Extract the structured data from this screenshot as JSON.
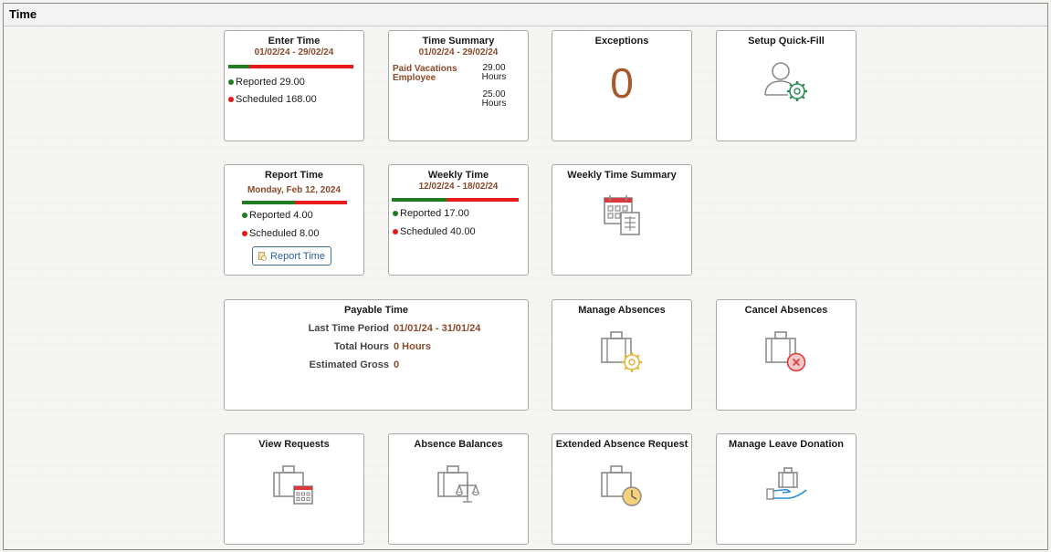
{
  "window": {
    "title": "Time"
  },
  "tiles": {
    "enter_time": {
      "title": "Enter Time",
      "date_range": "01/02/24 - 29/02/24",
      "reported_fraction": 0.17,
      "reported": "Reported 29.00",
      "scheduled": "Scheduled 168.00"
    },
    "time_summary": {
      "title": "Time Summary",
      "date_range": "01/02/24 - 29/02/24",
      "label_1": "Paid Vacations",
      "label_2": "Employee",
      "value_1_num": "29.00",
      "value_1_unit": "Hours",
      "value_2_num": "25.00",
      "value_2_unit": "Hours"
    },
    "exceptions": {
      "title": "Exceptions",
      "count": "0"
    },
    "setup_quickfill": {
      "title": "Setup Quick-Fill",
      "icon": "user-gear-icon"
    },
    "report_time": {
      "title": "Report Time",
      "date": "Monday, Feb 12, 2024",
      "reported_fraction": 0.5,
      "reported": "Reported 4.00",
      "scheduled": "Scheduled 8.00",
      "button_label": "Report Time"
    },
    "weekly_time": {
      "title": "Weekly Time",
      "date_range": "12/02/24 - 18/02/24",
      "reported_fraction": 0.43,
      "reported": "Reported 17.00",
      "scheduled": "Scheduled 40.00"
    },
    "weekly_time_summary": {
      "title": "Weekly Time Summary",
      "icon": "calendar-grid-icon"
    },
    "payable_time": {
      "title": "Payable Time",
      "rows": [
        {
          "label": "Last Time Period",
          "value": "01/01/24 - 31/01/24"
        },
        {
          "label": "Total Hours",
          "value": "0 Hours"
        },
        {
          "label": "Estimated Gross",
          "value": "0"
        }
      ]
    },
    "manage_absences": {
      "title": "Manage Absences",
      "icon": "briefcase-gear-icon"
    },
    "cancel_absences": {
      "title": "Cancel Absences",
      "icon": "briefcase-cancel-icon"
    },
    "view_requests": {
      "title": "View Requests",
      "icon": "briefcase-calendar-icon"
    },
    "absence_balances": {
      "title": "Absence Balances",
      "icon": "briefcase-scales-icon"
    },
    "extended_absence": {
      "title": "Extended Absence Request",
      "icon": "briefcase-clock-icon"
    },
    "leave_donation": {
      "title": "Manage Leave Donation",
      "icon": "hand-briefcase-icon"
    }
  },
  "colors": {
    "accent": "#8a4a2a",
    "reported": "#1f7d1f",
    "scheduled": "#e81b1b",
    "link": "#2b5f95",
    "icon_gold": "#e6b53a",
    "icon_green": "#2e8b57",
    "icon_red": "#d93a3a"
  }
}
